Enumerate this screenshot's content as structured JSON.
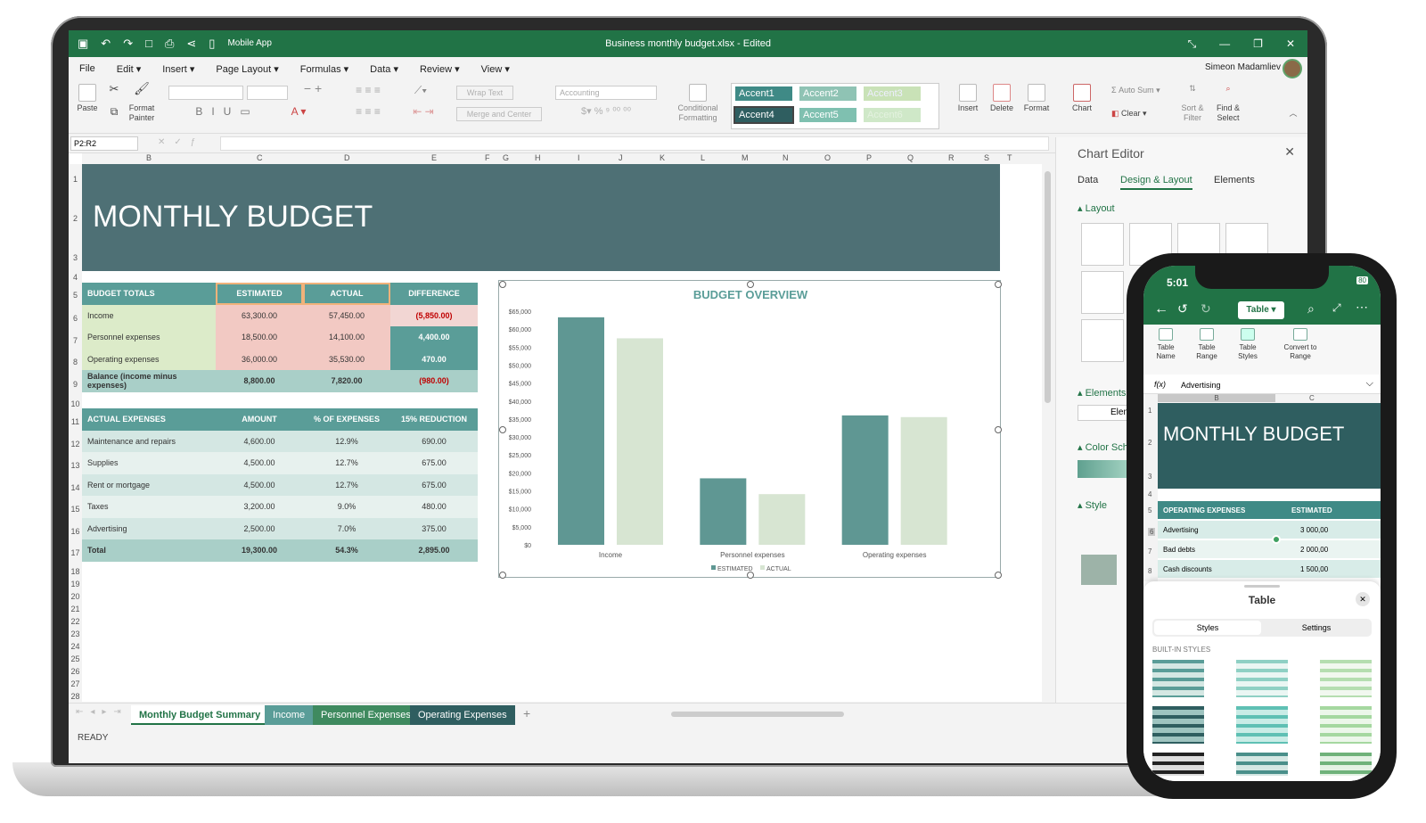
{
  "window": {
    "title": "Business monthly budget.xlsx - Edited",
    "mobile_app_label": "Mobile App",
    "user": "Simeon Madamliev"
  },
  "menu": [
    "File",
    "Edit",
    "Insert",
    "Page Layout",
    "Formulas",
    "Data",
    "Review",
    "View"
  ],
  "ribbon": {
    "paste": "Paste",
    "format_painter": "Format Painter",
    "wrap_text": "Wrap Text",
    "merge_center": "Merge and Center",
    "number_format": "Accounting",
    "conditional_formatting": "Conditional Formatting",
    "styles": [
      "Accent1",
      "Accent2",
      "Accent3",
      "Accent4",
      "Accent5",
      "Accent6"
    ],
    "insert": "Insert",
    "delete": "Delete",
    "format": "Format",
    "chart": "Chart",
    "auto_sum": "Auto Sum",
    "clear": "Clear",
    "sort_filter": "Sort & Filter",
    "find_select": "Find & Select"
  },
  "formula_bar": {
    "name_box": "P2:R2"
  },
  "columns": [
    "B",
    "C",
    "D",
    "E",
    "F",
    "G",
    "H",
    "I",
    "J",
    "K",
    "L",
    "M",
    "N",
    "O",
    "P",
    "Q",
    "R",
    "S",
    "T"
  ],
  "rows": [
    "1",
    "2",
    "3",
    "4",
    "5",
    "6",
    "7",
    "8",
    "9",
    "10",
    "11",
    "12",
    "13",
    "14",
    "15",
    "16",
    "17",
    "18",
    "19",
    "20",
    "21",
    "22",
    "23",
    "24",
    "25",
    "26",
    "27",
    "28"
  ],
  "banner_title": "MONTHLY BUDGET",
  "budget_totals": {
    "headers": [
      "BUDGET TOTALS",
      "ESTIMATED",
      "ACTUAL",
      "DIFFERENCE"
    ],
    "rows": [
      [
        "Income",
        "63,300.00",
        "57,450.00",
        "(5,850.00)"
      ],
      [
        "Personnel expenses",
        "18,500.00",
        "14,100.00",
        "4,400.00"
      ],
      [
        "Operating expenses",
        "36,000.00",
        "35,530.00",
        "470.00"
      ]
    ],
    "balance": [
      "Balance (income minus expenses)",
      "8,800.00",
      "7,820.00",
      "(980.00)"
    ]
  },
  "actual_expenses": {
    "headers": [
      "ACTUAL EXPENSES",
      "AMOUNT",
      "% OF EXPENSES",
      "15% REDUCTION"
    ],
    "rows": [
      [
        "Maintenance and repairs",
        "4,600.00",
        "12.9%",
        "690.00"
      ],
      [
        "Supplies",
        "4,500.00",
        "12.7%",
        "675.00"
      ],
      [
        "Rent or mortgage",
        "4,500.00",
        "12.7%",
        "675.00"
      ],
      [
        "Taxes",
        "3,200.00",
        "9.0%",
        "480.00"
      ],
      [
        "Advertising",
        "2,500.00",
        "7.0%",
        "375.00"
      ]
    ],
    "total": [
      "Total",
      "19,300.00",
      "54.3%",
      "2,895.00"
    ]
  },
  "chart_data": {
    "type": "bar",
    "title": "BUDGET OVERVIEW",
    "categories": [
      "Income",
      "Personnel expenses",
      "Operating expenses"
    ],
    "series": [
      {
        "name": "ESTIMATED",
        "values": [
          63300,
          18500,
          36000
        ],
        "color": "#5f9793"
      },
      {
        "name": "ACTUAL",
        "values": [
          57450,
          14100,
          35530
        ],
        "color": "#d7e5d2"
      }
    ],
    "ylim": [
      0,
      65000
    ],
    "yticks": [
      "$0",
      "$5,000",
      "$10,000",
      "$15,000",
      "$20,000",
      "$25,000",
      "$30,000",
      "$35,000",
      "$40,000",
      "$45,000",
      "$50,000",
      "$55,000",
      "$60,000",
      "$65,000"
    ],
    "legend": "bottom"
  },
  "sheet_tabs": [
    {
      "label": "Monthly Budget Summary",
      "color": "#ffffff",
      "text": "#217346"
    },
    {
      "label": "Income",
      "color": "#5a9d98",
      "text": "#ffffff"
    },
    {
      "label": "Personnel Expenses",
      "color": "#3f8a5f",
      "text": "#ffffff"
    },
    {
      "label": "Operating Expenses",
      "color": "#2f5e60",
      "text": "#ffffff"
    }
  ],
  "status": "READY",
  "chart_editor": {
    "title": "Chart Editor",
    "tabs": [
      "Data",
      "Design & Layout",
      "Elements"
    ],
    "sections": [
      "Layout",
      "Elements",
      "Color Scher",
      "Style"
    ],
    "elements_button": "Element"
  },
  "phone": {
    "time": "5:01",
    "battery": "80",
    "table_button": "Table",
    "tools": [
      "Table Name",
      "Table Range",
      "Table Styles",
      "Convert to Range"
    ],
    "fx_label": "f(x)",
    "fx_value": "Advertising",
    "cols": [
      "B",
      "C"
    ],
    "rows": [
      "1",
      "2",
      "3",
      "4",
      "5",
      "6",
      "7",
      "8"
    ],
    "banner": "MONTHLY BUDGET",
    "table_headers": [
      "OPERATING EXPENSES",
      "ESTIMATED"
    ],
    "table_rows": [
      [
        "Advertising",
        "3 000,00"
      ],
      [
        "Bad debts",
        "2 000,00"
      ],
      [
        "Cash discounts",
        "1 500,00"
      ]
    ],
    "sheet_title": "Table",
    "sheet_tabs": [
      "Styles",
      "Settings"
    ],
    "builtin": "BUILT-IN STYLES"
  },
  "colors": {
    "excel_green": "#217346",
    "banner": "#4e7075",
    "header_teal": "#5a9d98"
  }
}
